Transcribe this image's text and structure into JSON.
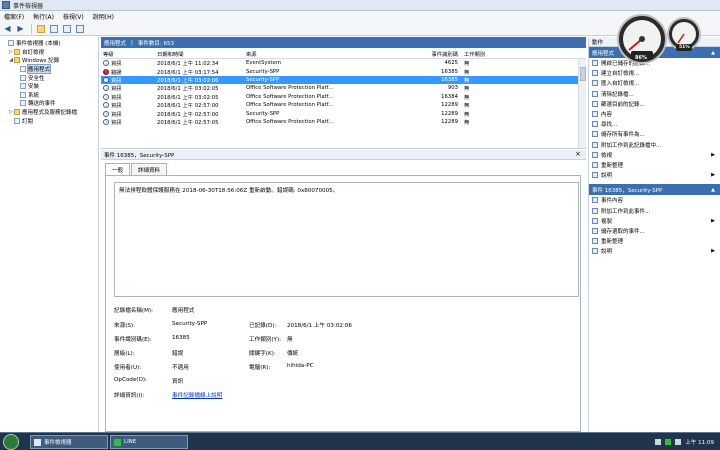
{
  "window": {
    "title": "事件檢視器"
  },
  "menu": [
    "檔案(F)",
    "執行(A)",
    "檢視(V)",
    "說明(H)"
  ],
  "tree": [
    {
      "label": "事件檢視器 (本機)",
      "exp": "",
      "icon": "computer-icon",
      "indent": 0
    },
    {
      "label": "自訂檢視",
      "exp": "▷",
      "icon": "folder-icon",
      "indent": 1
    },
    {
      "label": "Windows 記錄",
      "exp": "◢",
      "icon": "folder-icon",
      "indent": 1
    },
    {
      "label": "應用程式",
      "exp": "",
      "icon": "log-icon",
      "indent": 2,
      "selected": true
    },
    {
      "label": "安全性",
      "exp": "",
      "icon": "log-icon",
      "indent": 2
    },
    {
      "label": "安裝",
      "exp": "",
      "icon": "log-icon",
      "indent": 2
    },
    {
      "label": "系統",
      "exp": "",
      "icon": "log-icon",
      "indent": 2
    },
    {
      "label": "轉送的事件",
      "exp": "",
      "icon": "log-icon",
      "indent": 2
    },
    {
      "label": "應用程式及服務記錄檔",
      "exp": "▷",
      "icon": "folder-icon",
      "indent": 1
    },
    {
      "label": "訂閱",
      "exp": "",
      "icon": "log-icon",
      "indent": 1
    }
  ],
  "center": {
    "header_title": "應用程式",
    "header_count": "事件數目: 653",
    "columns": [
      "等級",
      "日期和時間",
      "來源",
      "事件識別碼",
      "工作類別"
    ],
    "rows": [
      {
        "level": "資訊",
        "type": "info",
        "date": "2018/6/1 上午 11:02:34",
        "source": "EventSystem",
        "id": "4625",
        "cat": "無"
      },
      {
        "level": "錯誤",
        "type": "error",
        "date": "2018/6/1 上午 03:17:54",
        "source": "Security-SPP",
        "id": "16385",
        "cat": "無"
      },
      {
        "level": "資訊",
        "type": "info",
        "date": "2018/6/1 上午 03:02:06",
        "source": "Security-SPP",
        "id": "16385",
        "cat": "無",
        "selected": true
      },
      {
        "level": "資訊",
        "type": "info",
        "date": "2018/6/1 上午 03:02:05",
        "source": "Office Software Protection Platf...",
        "id": "903",
        "cat": "無"
      },
      {
        "level": "資訊",
        "type": "info",
        "date": "2018/6/1 上午 03:02:05",
        "source": "Office Software Protection Platf...",
        "id": "16384",
        "cat": "無"
      },
      {
        "level": "資訊",
        "type": "info",
        "date": "2018/6/1 上午 02:57:00",
        "source": "Office Software Protection Platf...",
        "id": "12289",
        "cat": "無"
      },
      {
        "level": "資訊",
        "type": "info",
        "date": "2018/6/1 上午 02:57:00",
        "source": "Security-SPP",
        "id": "12289",
        "cat": "無"
      },
      {
        "level": "資訊",
        "type": "info",
        "date": "2018/6/1 上午 02:57:05",
        "source": "Office Software Protection Platf...",
        "id": "12289",
        "cat": "無"
      }
    ]
  },
  "detail": {
    "title": "事件 16385，Security-SPP",
    "tabs": [
      "一般",
      "詳細資料"
    ],
    "description": "無法排程軟體保護服務在 2018-06-30T18:56:06Z 重新啟動。錯誤碼: 0x80070005。",
    "fields": {
      "log_name_label": "記錄檔名稱(M):",
      "log_name": "應用程式",
      "source_label": "來源(S):",
      "source": "Security-SPP",
      "logged_label": "已記錄(D):",
      "logged": "2018/6/1 上午 03:02:06",
      "event_id_label": "事件識別碼(E):",
      "event_id": "16385",
      "task_label": "工作類別(Y):",
      "task": "無",
      "level_label": "層級(L):",
      "level": "錯誤",
      "keywords_label": "關鍵字(K):",
      "keywords": "傳統",
      "user_label": "使用者(U):",
      "user": "不適用",
      "computer_label": "電腦(R):",
      "computer": "hihida-PC",
      "opcode_label": "OpCode(O):",
      "opcode": "資訊",
      "more_label": "詳細資訊(I):",
      "more_link": "事件記錄檔線上說明"
    }
  },
  "actions": {
    "header": "動作",
    "section1": "應用程式",
    "items1": [
      {
        "label": "開啟已儲存的記錄...",
        "sub": ""
      },
      {
        "label": "建立自訂檢視...",
        "sub": ""
      },
      {
        "label": "匯入自訂檢視...",
        "sub": ""
      },
      {
        "label": "清除記錄檔...",
        "sub": ""
      },
      {
        "label": "篩選目前的記錄...",
        "sub": ""
      },
      {
        "label": "內容",
        "sub": ""
      },
      {
        "label": "尋找...",
        "sub": ""
      },
      {
        "label": "儲存所有事件為...",
        "sub": ""
      },
      {
        "label": "附加工作到此記錄檔中...",
        "sub": ""
      },
      {
        "label": "檢視",
        "sub": "▶"
      },
      {
        "label": "重新整理",
        "sub": ""
      },
      {
        "label": "說明",
        "sub": "▶"
      }
    ],
    "section2": "事件 16385，Security-SPP",
    "items2": [
      {
        "label": "事件內容",
        "sub": ""
      },
      {
        "label": "附加工作到此事件...",
        "sub": ""
      },
      {
        "label": "複製",
        "sub": "▶"
      },
      {
        "label": "儲存選取的事件...",
        "sub": ""
      },
      {
        "label": "重新整理",
        "sub": ""
      },
      {
        "label": "說明",
        "sub": "▶"
      }
    ]
  },
  "gadget": {
    "cpu": "86%",
    "mem": "51%"
  },
  "taskbar": {
    "app1": "事件檢視器",
    "app2": "LINE",
    "clock": "上午 11:09"
  }
}
